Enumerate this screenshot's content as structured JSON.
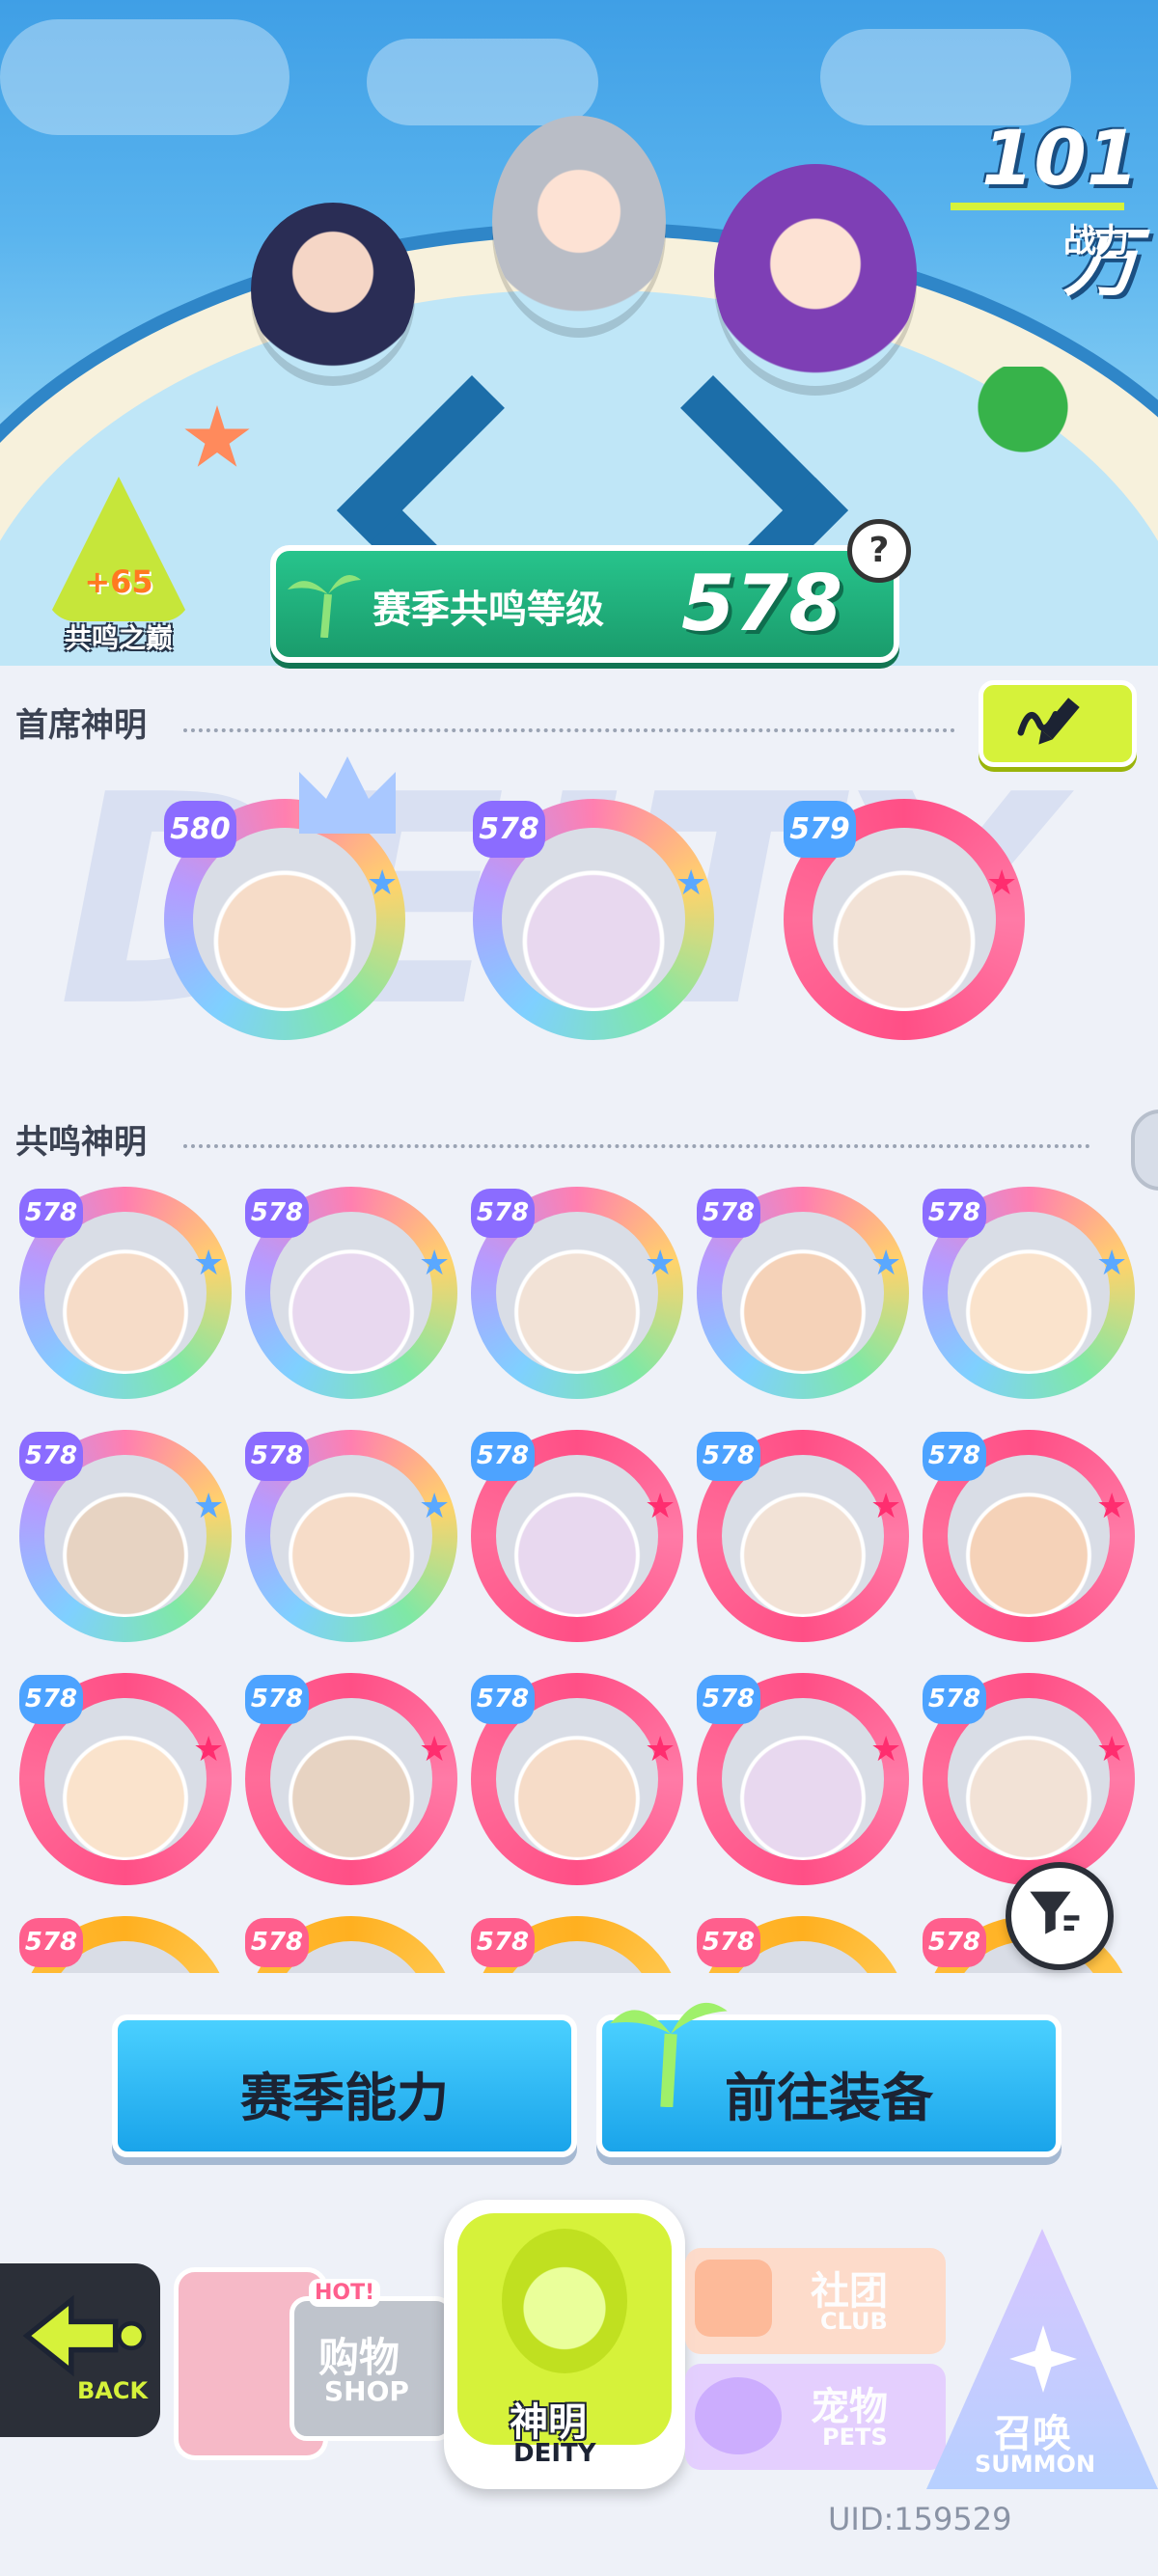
{
  "header": {
    "power_value": "101万",
    "power_label": "战力",
    "peak_badge": {
      "value": "+65",
      "label": "共鸣之巅"
    },
    "resonance": {
      "label": "赛季共鸣等级",
      "level": "578"
    },
    "help_icon": "question-icon"
  },
  "featured_section": {
    "title": "首席神明",
    "edit_icon": "pencil-icon",
    "deities": [
      {
        "level": "580",
        "frame": "rainbow",
        "crown": true
      },
      {
        "level": "578",
        "frame": "rainbow",
        "crown": false
      },
      {
        "level": "579",
        "frame": "pink",
        "crown": false
      }
    ]
  },
  "resonance_section": {
    "title": "共鸣神明",
    "rows": [
      [
        {
          "level": "578",
          "frame": "rainbow"
        },
        {
          "level": "578",
          "frame": "rainbow"
        },
        {
          "level": "578",
          "frame": "rainbow"
        },
        {
          "level": "578",
          "frame": "rainbow"
        },
        {
          "level": "578",
          "frame": "rainbow"
        }
      ],
      [
        {
          "level": "578",
          "frame": "rainbow"
        },
        {
          "level": "578",
          "frame": "rainbow"
        },
        {
          "level": "578",
          "frame": "pink"
        },
        {
          "level": "578",
          "frame": "pink"
        },
        {
          "level": "578",
          "frame": "pink"
        }
      ],
      [
        {
          "level": "578",
          "frame": "pink"
        },
        {
          "level": "578",
          "frame": "pink"
        },
        {
          "level": "578",
          "frame": "pink"
        },
        {
          "level": "578",
          "frame": "pink"
        },
        {
          "level": "578",
          "frame": "pink"
        }
      ],
      [
        {
          "level": "578",
          "frame": "orange"
        },
        {
          "level": "578",
          "frame": "orange"
        },
        {
          "level": "578",
          "frame": "orange"
        },
        {
          "level": "578",
          "frame": "orange"
        },
        {
          "level": "578",
          "frame": "orange"
        }
      ]
    ]
  },
  "actions": {
    "season_ability": "赛季能力",
    "go_equip": "前往装备"
  },
  "nav": {
    "back": "BACK",
    "shop_cn": "购物",
    "shop_en": "SHOP",
    "shop_hot": "HOT!",
    "deity_cn": "神明",
    "deity_en": "DEITY",
    "club_cn": "社团",
    "club_en": "CLUB",
    "pets_cn": "宠物",
    "pets_en": "PETS",
    "summon_cn": "召唤",
    "summon_en": "SUMMON"
  },
  "uid": "UID:159529",
  "colors": {
    "accent_lime": "#d6f23a",
    "accent_green": "#27c48c",
    "accent_blue": "#1aa4ea",
    "frame_pink": "#ff4f86",
    "frame_orange": "#ffb020"
  }
}
